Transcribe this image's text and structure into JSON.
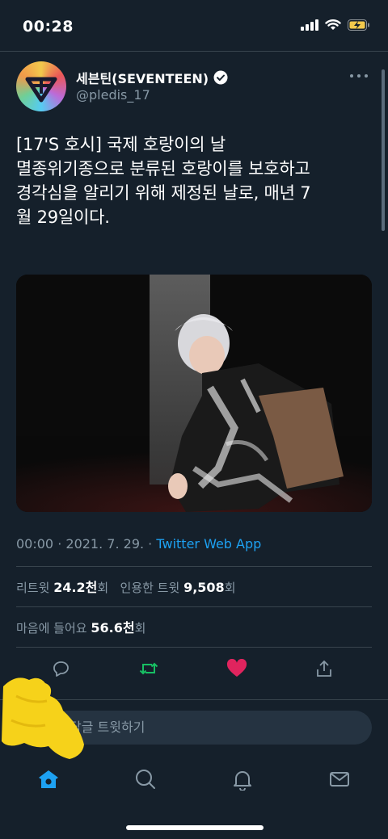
{
  "status": {
    "time": "00:28"
  },
  "tweet": {
    "display_name": "세븐틴(SEVENTEEN)",
    "handle": "@pledis_17",
    "text_lines": [
      "[17'S 호시] 국제 호랑이의 날",
      "멸종위기종으로 분류된 호랑이를 보호하고",
      "경각심을 알리기 위해 제정된 날로, 매년 7",
      "월 29일이다."
    ],
    "meta": {
      "time": "00:00",
      "date": "2021. 7. 29.",
      "separator": "·",
      "source_app": "Twitter Web App"
    },
    "stats": {
      "retweets_label": "리트윗",
      "retweets_count": "24.2천",
      "retweets_unit": "회",
      "quotes_label": "인용한 트윗",
      "quotes_count": "9,508",
      "quotes_unit": "회",
      "likes_label": "마음에 들어요",
      "likes_count": "56.6천",
      "likes_unit": "회"
    }
  },
  "reply_bar": {
    "placeholder": "답글 트윗하기"
  },
  "icons": {
    "reply": "reply-icon",
    "retweet": "retweet-icon",
    "like": "heart-icon",
    "share": "share-icon",
    "home": "home-icon",
    "search": "search-icon",
    "notifications": "bell-icon",
    "messages": "mail-icon",
    "verified": "verified-badge-icon",
    "more": "more-icon"
  },
  "colors": {
    "background": "#15202b",
    "accent": "#1da1f2",
    "retweet_active": "#17bf63",
    "like_active": "#e0245e",
    "secondary_text": "#8899a6"
  }
}
